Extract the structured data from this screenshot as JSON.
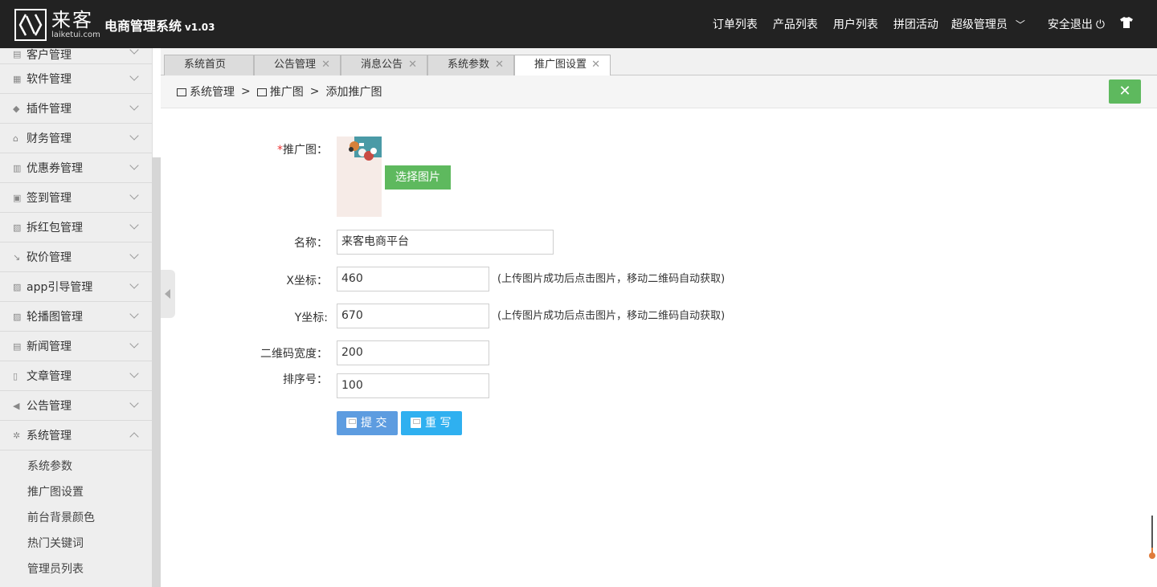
{
  "header": {
    "logo_cn": "来客",
    "logo_en": "laiketui.com",
    "title": "电商管理系统",
    "version": "v1.03",
    "nav": [
      "订单列表",
      "产品列表",
      "用户列表",
      "拼团活动"
    ],
    "admin_label": "超级管理员",
    "logout_label": "安全退出"
  },
  "sidebar": {
    "items": [
      {
        "label": "客户管理",
        "icon": "document-icon"
      },
      {
        "label": "软件管理",
        "icon": "grid-icon"
      },
      {
        "label": "插件管理",
        "icon": "puzzle-icon"
      },
      {
        "label": "财务管理",
        "icon": "bank-icon"
      },
      {
        "label": "优惠券管理",
        "icon": "coupon-icon"
      },
      {
        "label": "签到管理",
        "icon": "clipboard-icon"
      },
      {
        "label": "拆红包管理",
        "icon": "envelope-icon"
      },
      {
        "label": "砍价管理",
        "icon": "trend-icon"
      },
      {
        "label": "app引导管理",
        "icon": "image-icon"
      },
      {
        "label": "轮播图管理",
        "icon": "image-icon"
      },
      {
        "label": "新闻管理",
        "icon": "newspaper-icon"
      },
      {
        "label": "文章管理",
        "icon": "file-icon"
      },
      {
        "label": "公告管理",
        "icon": "speaker-icon"
      },
      {
        "label": "系统管理",
        "icon": "gear-icon"
      }
    ],
    "subitems": [
      "系统参数",
      "推广图设置",
      "前台背景颜色",
      "热门关键词",
      "管理员列表"
    ]
  },
  "tabs": [
    {
      "label": "系统首页"
    },
    {
      "label": "公告管理"
    },
    {
      "label": "消息公告"
    },
    {
      "label": "系统参数"
    },
    {
      "label": "推广图设置"
    }
  ],
  "breadcrumb": {
    "root": "系统管理",
    "sep": ">",
    "level2": "推广图",
    "current": "添加推广图"
  },
  "form": {
    "image_label": "推广图：",
    "image_required": "*",
    "pick_button": "选择图片",
    "name_label": "名称：",
    "name_value": "来客电商平台",
    "x_label": "X坐标：",
    "x_value": "460",
    "x_hint": "(上传图片成功后点击图片，移动二维码自动获取)",
    "y_label": "Y坐标:",
    "y_value": "670",
    "y_hint": "(上传图片成功后点击图片，移动二维码自动获取)",
    "qr_label": "二维码宽度：",
    "qr_value": "200",
    "sort_label": "排序号：",
    "sort_value": "100",
    "submit_label": "提 交",
    "reset_label": "重 写"
  },
  "colors": {
    "header_bg": "#222222",
    "green": "#5eb95e",
    "submit_blue": "#5d9ce0",
    "reset_blue": "#2fb0f0"
  }
}
